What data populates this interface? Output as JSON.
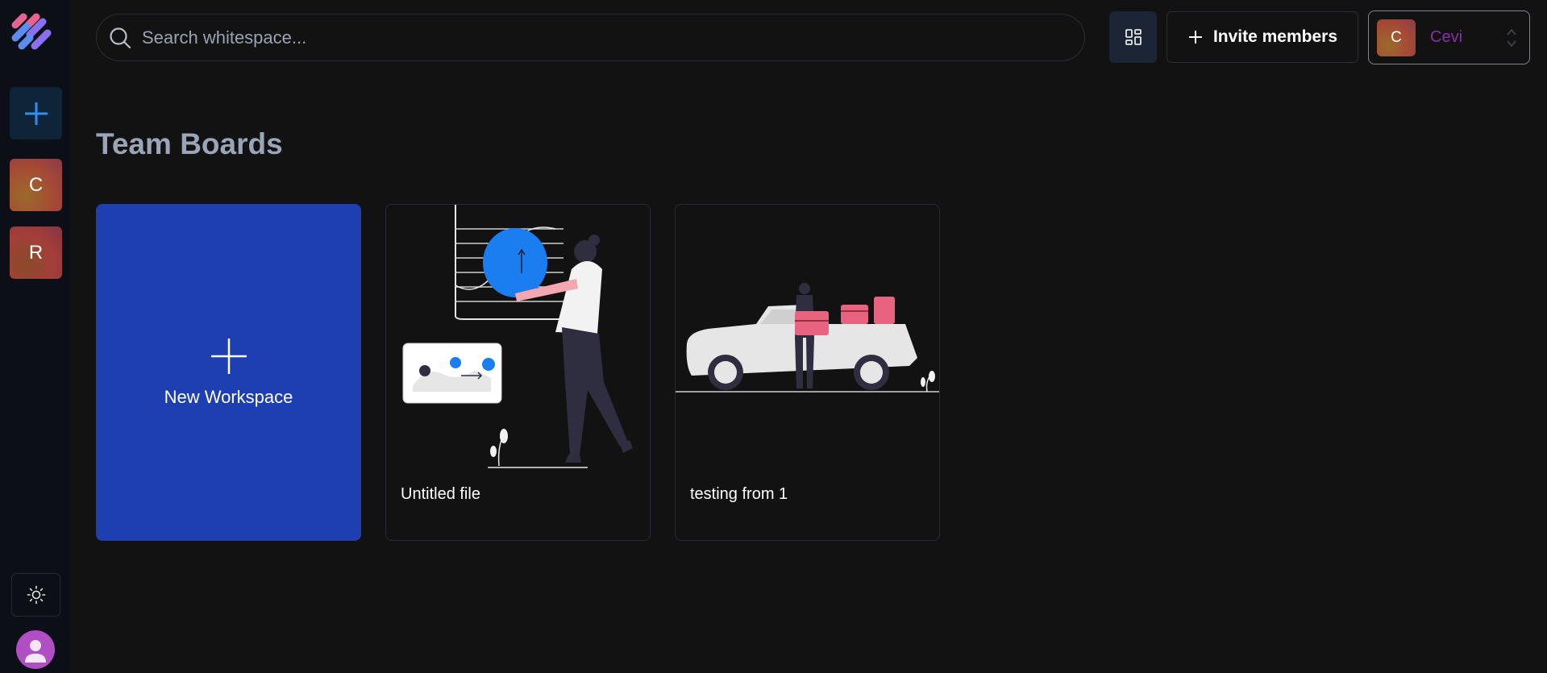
{
  "sidebar": {
    "logo": "app-logo",
    "add_icon": "plus-icon",
    "workspaces": [
      {
        "initial": "C"
      },
      {
        "initial": "R"
      }
    ],
    "theme_icon": "sun-icon",
    "user_icon": "user-icon"
  },
  "header": {
    "search_placeholder": "Search whitespace...",
    "view_icon": "grid-icon",
    "invite_label": "Invite members",
    "workspace": {
      "initial": "C",
      "name": "Cevi"
    }
  },
  "main": {
    "title": "Team Boards",
    "new_workspace_label": "New Workspace",
    "boards": [
      {
        "name": "Untitled file"
      },
      {
        "name": "testing from 1"
      }
    ]
  },
  "colors": {
    "background": "#121212",
    "sidebar": "#0c1016",
    "accent_blue": "#1e3fb2",
    "title": "#9aa5b8",
    "workspace_name": "#8a2fa8"
  }
}
